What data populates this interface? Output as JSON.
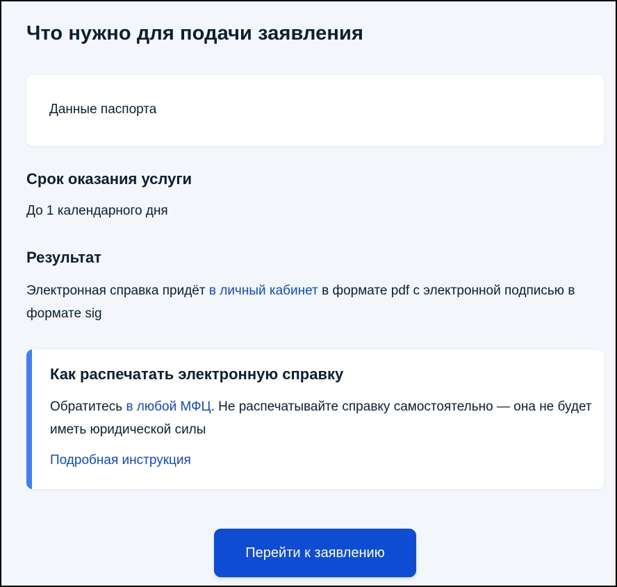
{
  "page": {
    "title": "Что нужно для подачи заявления"
  },
  "documents": {
    "items": [
      "Данные паспорта"
    ]
  },
  "term": {
    "heading": "Срок оказания услуги",
    "text": "До 1 календарного дня"
  },
  "result": {
    "heading": "Результат",
    "text_before": "Электронная справка придёт ",
    "link": "в личный кабинет",
    "text_after": " в формате pdf с электронной подписью в формате sig"
  },
  "print_info": {
    "title": "Как распечатать электронную справку",
    "text_before": "Обратитесь ",
    "link": "в любой МФЦ",
    "text_after": ". Не распечатывайте справку самостоятельно — она не будет иметь юридической силы",
    "instruction_link": "Подробная инструкция",
    "accent_color": "#3f7ff0"
  },
  "actions": {
    "apply_button": "Перейти к заявлению"
  },
  "colors": {
    "background": "#f3f6fb",
    "link": "#0d4cd3",
    "button": "#0d4cd3",
    "text": "#0b1f33"
  }
}
